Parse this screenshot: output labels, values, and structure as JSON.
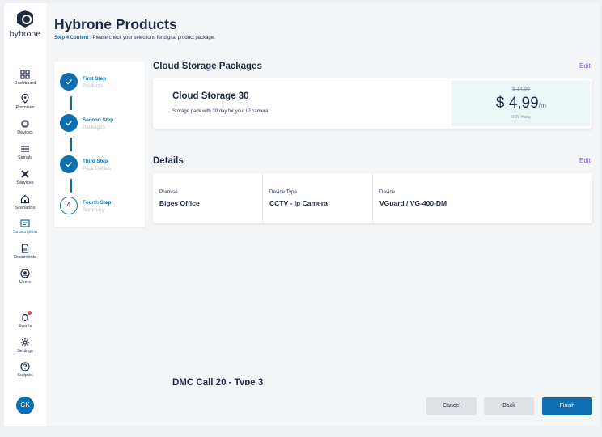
{
  "brand": {
    "logo_text": "hybrone"
  },
  "sidebar": {
    "items": [
      {
        "label": "Dashboard",
        "icon": "dashboard-icon"
      },
      {
        "label": "Premises",
        "icon": "location-pin-icon"
      },
      {
        "label": "Devices",
        "icon": "chip-icon"
      },
      {
        "label": "Signals",
        "icon": "list-icon"
      },
      {
        "label": "Services",
        "icon": "tools-icon"
      },
      {
        "label": "Scenarios",
        "icon": "home-icon"
      },
      {
        "label": "Subscription",
        "icon": "subscription-icon",
        "active": true
      },
      {
        "label": "Documents",
        "icon": "document-icon"
      },
      {
        "label": "Users",
        "icon": "user-icon"
      }
    ],
    "bottom_items": [
      {
        "label": "Events",
        "icon": "bell-icon"
      },
      {
        "label": "Settings",
        "icon": "gear-icon"
      },
      {
        "label": "Support",
        "icon": "help-icon"
      }
    ],
    "avatar_initials": "GK"
  },
  "page": {
    "title": "Hybrone Products",
    "step_tag": "Step 4 Content :",
    "step_description": " Please check your selections for digital product package."
  },
  "stepper": {
    "steps": [
      {
        "title": "First Step",
        "subtitle": "Products",
        "status": "done"
      },
      {
        "title": "Second Step",
        "subtitle": "Packages",
        "status": "done"
      },
      {
        "title": "Third Step",
        "subtitle": "Pack Details",
        "status": "done"
      },
      {
        "title": "Fourth Step",
        "subtitle": "Summary",
        "status": "current",
        "number": "4"
      }
    ]
  },
  "packages_section": {
    "title": "Cloud Storage Packages",
    "edit_label": "Edit",
    "package": {
      "name": "Cloud Storage 30",
      "description": "Storage pack with 30 day for your IP camera.",
      "old_price": "$ 14,99",
      "price": "$ 4,99",
      "price_unit": "/m",
      "tax_note": "KDV Hariç"
    }
  },
  "details_section": {
    "title": "Details",
    "edit_label": "Edit",
    "fields": [
      {
        "label": "Premise",
        "value": "Biges Office"
      },
      {
        "label": "Device Type",
        "value": "CCTV - Ip Camera"
      },
      {
        "label": "Device",
        "value": "VGuard / VG-400-DM"
      }
    ]
  },
  "clipped_item": {
    "text": "DMC Call 20 - Type 3"
  },
  "footer": {
    "cancel_label": "Cancel",
    "back_label": "Back",
    "finish_label": "Finish"
  },
  "colors": {
    "primary": "#0d6fb0",
    "edit_link": "#8a5ad8",
    "text_dark": "#1e2a44",
    "price_bg": "#edf6f7"
  }
}
